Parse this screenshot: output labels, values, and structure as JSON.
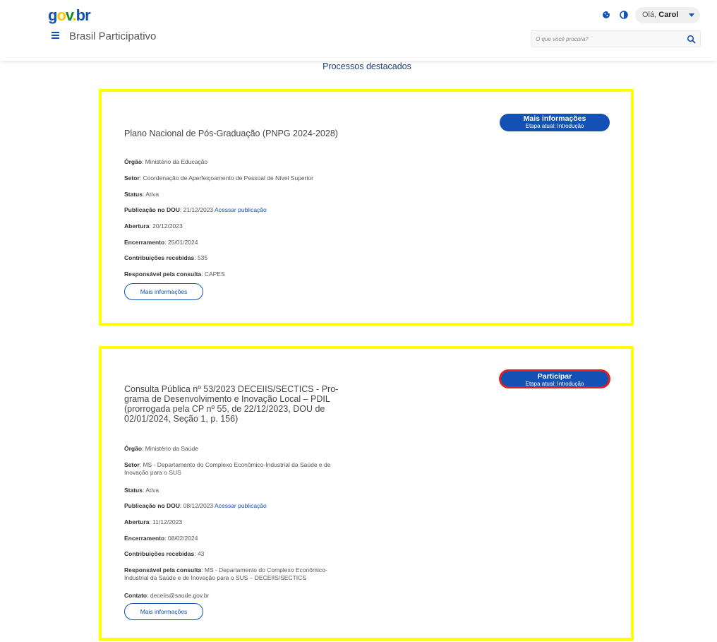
{
  "header": {
    "logo": {
      "g": "g",
      "o": "o",
      "v": "v",
      "dot": ".",
      "b": "b",
      "r": "r"
    },
    "site_title": "Brasil Participativo",
    "user": {
      "greeting": "Olá,",
      "name": "Carol"
    },
    "search_placeholder": "O que você procura?",
    "icons": {
      "menu": "hamburger-menu-icon",
      "cookie": "cookie-icon",
      "contrast": "contrast-icon",
      "search": "search-icon",
      "user_caret": "caret-down-icon"
    },
    "colors": {
      "brand_blue": "#1351b4",
      "brand_yellow": "#f7c600",
      "brand_green": "#168821"
    }
  },
  "section_title": "Processos destacados",
  "processes": [
    {
      "title": "Plano Nacional de Pós-Graduação (PNPG 2024-2028)",
      "action": {
        "label": "Mais informações",
        "stage": "Etapa atual: Introdução"
      },
      "fields": [
        {
          "key": "Órgão",
          "value": " Ministério da Educação"
        },
        {
          "key": "Setor",
          "value": " Coordenação de Aperfeiçoamento de Pessoal de Nível Superior"
        },
        {
          "key": "Status",
          "value": " Ativa"
        },
        {
          "key": "Publicação no DOU",
          "value": " 21/12/2023 ",
          "link": "Acessar publicação"
        },
        {
          "key": "Abertura",
          "value": " 20/12/2023"
        },
        {
          "key": "Encerramento",
          "value": " 25/01/2024"
        },
        {
          "key": "Contribuições recebidas",
          "value": " 535"
        },
        {
          "key": "Responsável pela consulta",
          "value": " CAPES"
        }
      ],
      "more_button": "Mais informações"
    },
    {
      "title": "Consulta Pública nº 53/2023 DECEIIS/SECTICS - Pro-grama de Desenvolvimento e Inovação Local – PDIL (prorrogada pela CP nº 55, de 22/12/2023, DOU de 02/01/2024, Seção 1, p. 156)",
      "action": {
        "label": "Participar",
        "stage": "Etapa atual: Introdução"
      },
      "fields": [
        {
          "key": "Órgão",
          "value": " Ministério da Saúde"
        },
        {
          "key": "Setor",
          "value": " MS - Departamento do Complexo Econômico-Industrial da Saúde e de Inovação para o SUS"
        },
        {
          "key": "Status",
          "value": " Ativa"
        },
        {
          "key": "Publicação no DOU",
          "value": " 08/12/2023 ",
          "link": "Acessar publicação"
        },
        {
          "key": "Abertura",
          "value": " 11/12/2023"
        },
        {
          "key": "Encerramento",
          "value": " 08/02/2024"
        },
        {
          "key": "Contribuições recebidas",
          "value": " 43"
        },
        {
          "key": "Responsável pela consulta",
          "value": " MS - Departamento do Complexo Econômico-Industrial da Saúde e de Inovação para o SUS – DECEIIS/SECTICS"
        },
        {
          "key": "Contato",
          "value": " deceiis@saude.gov.br"
        }
      ],
      "more_button": "Mais informações"
    }
  ]
}
